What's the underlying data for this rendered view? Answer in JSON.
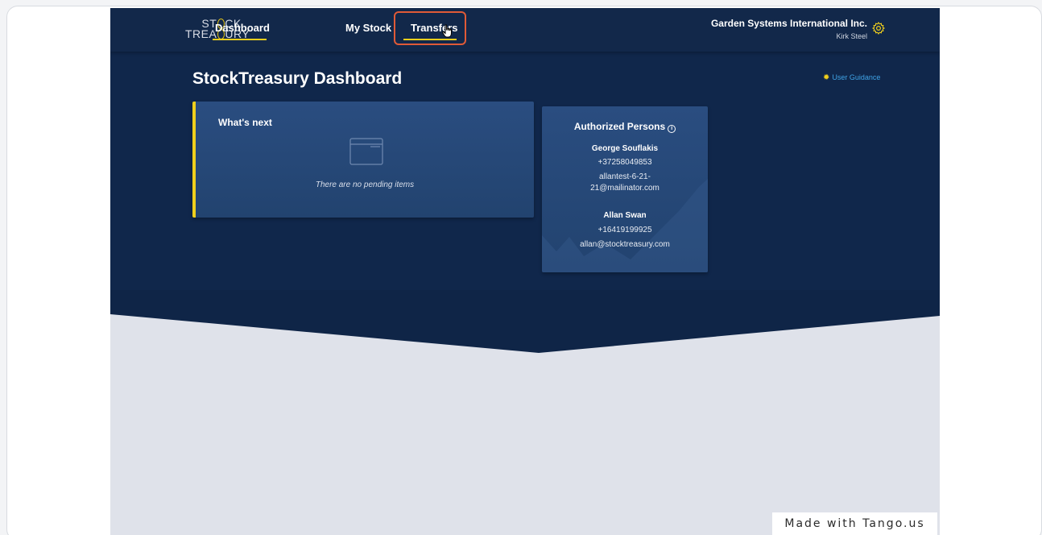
{
  "colors": {
    "nav_bg": "#12284a",
    "hero_bg": "#0f2547",
    "card_bg": "#274a7b",
    "accent_yellow": "#f0cf1c",
    "highlight_red": "#e05a37",
    "link_blue": "#3fa3e6",
    "page_bg": "#dfe2ea"
  },
  "nav": {
    "logo_line1_a": "ST",
    "logo_line1_b": "CK",
    "logo_line2_a": "TREA",
    "logo_line2_b": "URY",
    "items": [
      {
        "label": "Dashboard",
        "active": true
      },
      {
        "label": "My Stock",
        "active": false
      },
      {
        "label": "Transfers",
        "active": false,
        "highlighted": true
      }
    ],
    "company": "Garden Systems International Inc.",
    "user": "Kirk Steel",
    "settings_icon": "gear-icon",
    "cursor_icon": "hand-pointer-icon"
  },
  "main": {
    "title": "StockTreasury Dashboard",
    "guidance_label": "User Guidance",
    "guidance_icon": "lightbulb-icon"
  },
  "whats_next": {
    "title": "What's next",
    "empty_icon": "empty-window-icon",
    "empty_text": "There are no pending items"
  },
  "authorized": {
    "title": "Authorized Persons",
    "info_icon": "info-icon",
    "persons": [
      {
        "name": "George Souflakis",
        "phone": "+37258049853",
        "email_line1": "allantest-6-21-",
        "email_line2": "21@mailinator.com"
      },
      {
        "name": "Allan Swan",
        "phone": "+16419199925",
        "email_line1": "allan@stocktreasury.com",
        "email_line2": ""
      }
    ]
  },
  "watermark": "Made with Tango.us"
}
